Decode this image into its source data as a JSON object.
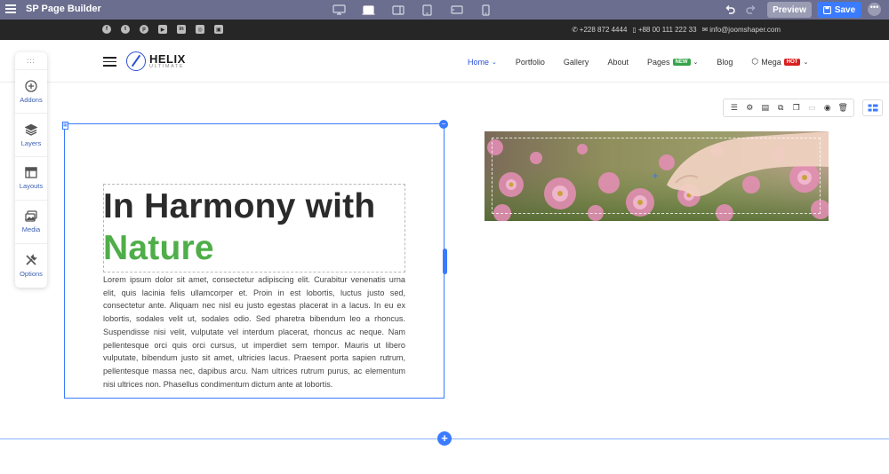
{
  "builder": {
    "title": "SP Page Builder",
    "preview_label": "Preview",
    "save_label": "Save",
    "more_label": "•••"
  },
  "devices": [
    "desktop-icon",
    "laptop-icon",
    "tablet-landscape-icon",
    "tablet-icon",
    "mobile-landscape-icon",
    "mobile-icon"
  ],
  "topbar": {
    "social": [
      "f",
      "t",
      "p",
      "▶",
      "in",
      "◎",
      "▣"
    ],
    "phone": "+228 872 4444",
    "mobile": "+88 00 111 222 33",
    "email": "info@joomshaper.com"
  },
  "header": {
    "logo_name": "HELIX",
    "logo_sub": "ULTIMATE",
    "nav": {
      "home": "Home",
      "portfolio": "Portfolio",
      "gallery": "Gallery",
      "about": "About",
      "pages": "Pages",
      "pages_badge": "NEW",
      "blog": "Blog",
      "mega": "Mega",
      "mega_badge": "HOT"
    }
  },
  "side_panel": {
    "grip": ":::",
    "addons": "Addons",
    "layers": "Layers",
    "layouts": "Layouts",
    "media": "Media",
    "options": "Options"
  },
  "content": {
    "heading_line1": "In Harmony with",
    "heading_line2": "Nature",
    "paragraph": "Lorem ipsum dolor sit amet, consectetur adipiscing elit. Curabitur venenatis urna elit, quis lacinia felis ullamcorper et. Proin in est lobortis, luctus justo sed, consectetur ante. Aliquam nec nisl eu justo egestas placerat in a lacus. In eu ex lobortis, sodales velit ut, sodales odio. Sed pharetra bibendum leo a rhoncus. Suspendisse nisi velit, vulputate vel interdum placerat, rhoncus ac neque. Nam pellentesque orci quis orci cursus, ut imperdiet sem tempor. Mauris ut libero vulputate, bibendum justo sit amet, ultricies lacus. Praesent porta sapien rutrum, pellentesque massa nec, dapibus arcu. Nam ultrices rutrum purus, ac elementum nisi ultrices non. Phasellus condimentum dictum ante at lobortis."
  },
  "colors": {
    "builder_bar": "#6b6e8e",
    "accent": "#3a7bff",
    "heading_green": "#4fae49",
    "nav_active": "#2a4fd6"
  }
}
